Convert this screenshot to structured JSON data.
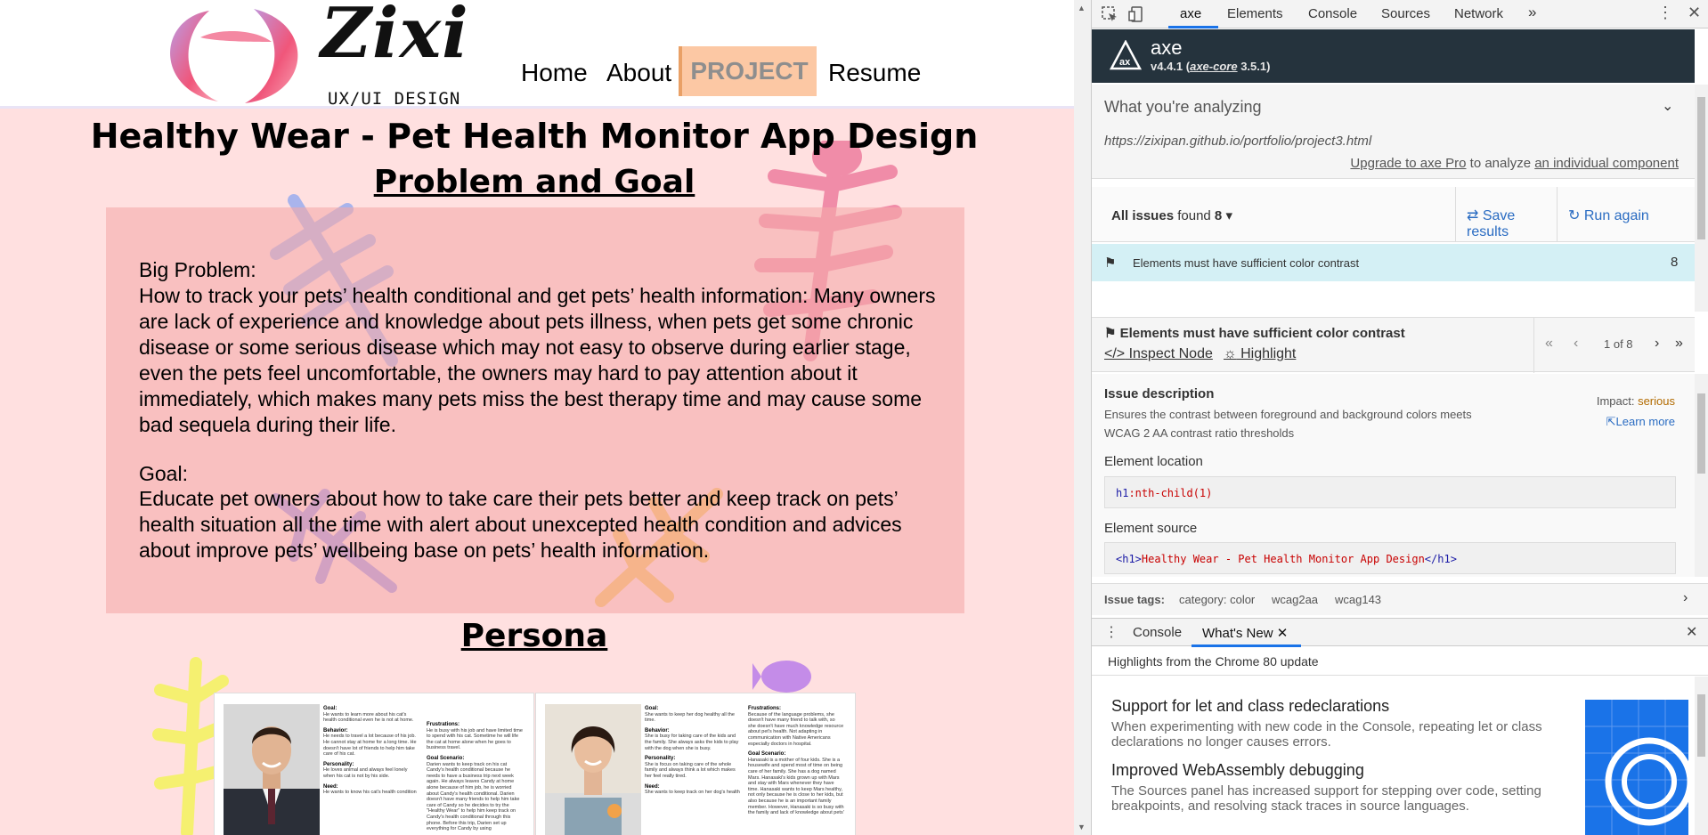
{
  "site": {
    "logo": {
      "text": "Zixi",
      "subtitle": "UX/UI DESIGN"
    },
    "nav": {
      "home": "Home",
      "about": "About",
      "project": "PROJECT",
      "resume": "Resume"
    },
    "title": "Healthy Wear - Pet Health Monitor App Design",
    "problem_section": {
      "heading": "Problem and Goal",
      "big_problem_label": "Big Problem:",
      "big_problem_text": "How to track your pets’ health conditional and get pets’ health information: Many owners are lack of experience and knowledge about pets illness, when pets get some chronic disease or some serious disease which may not easy to observe during earlier stage, even the pets feel uncomfortable, the owners may hard to pay attention about it immediately, which makes many pets miss the best therapy time and may cause some bad sequela during their life.",
      "goal_label": "Goal:",
      "goal_text": "Educate pet owners about how to take care their pets better and keep track on pets’ health situation all the time with alert about unexcepted health condition and advices about improve pets’ wellbeing base on pets’ health information."
    },
    "persona_heading": "Persona",
    "personas": [
      {
        "col1": [
          {
            "h": "Goal:",
            "t": "He wants to learn more about his cat's health conditional even he is not at home."
          },
          {
            "h": "Behavior:",
            "t": "He needs to travel a lot because of his job. He cannot stay at home for a long time. He doesn't have lot of friends to help him take care of his cat."
          },
          {
            "h": "Personality:",
            "t": "He loves animal and always feel lonely when his cat is not by his side."
          },
          {
            "h": "Need:",
            "t": "He wants to know his cat's health condition"
          }
        ],
        "col2": [
          {
            "h": "Frustrations:",
            "t": "He is busy with his job and have limited time to spend with his cat. Sometime he will life the cat at home alone when he goes to business travel."
          },
          {
            "h": "Goal Scenario:",
            "t": "Darien wants to keep track on his cat Candy's health conditional because he needs to have a business trip next week again. He always leaves Candy at home alone because of him job, he is worried about Candy's health conditional. Darien doesn't have many friends to help him take care of Candy so he decides to try the \"Healthy Wear\" to help him keep track on Candy's health conditional through this phone. Before this trip, Darien set up everything for Candy by using"
          }
        ]
      },
      {
        "col1": [
          {
            "h": "Goal:",
            "t": "She wants to keep her dog healthy all the time."
          },
          {
            "h": "Behavior:",
            "t": "She is busy for taking care of the kids and the family. She always asks the kids to play with the dog when she is busy."
          },
          {
            "h": "Personality:",
            "t": "She is focus on taking care of the whole family and always think a lot which makes her feel really tired."
          },
          {
            "h": "Need:",
            "t": "She wants to keep track on her dog's health"
          }
        ],
        "col2": [
          {
            "h": "Frustrations:",
            "t": "Because of the language problems, she doesn't have many friend to talk with, so she doesn't have much knowledge resource about pet's health. Not adapting in communication with Native Americans especially doctors in hospital."
          },
          {
            "h": "Goal Scenario:",
            "t": "Hanasaki is a mother of four kids. She is a housewife and spend most of time on being care of her family. She has a dog named Mars. Hanasaki's kids grown up with Mars and stay with Mars whenever they have time. Hanasaki wants to keep Mars healthy, not only because he is close to her kids, but also because he is an important family member. However, Hanasaki is so busy with the family and lack of knowledge about pets'"
          }
        ]
      }
    ]
  },
  "devtools": {
    "tabs": [
      "axe",
      "Elements",
      "Console",
      "Sources",
      "Network"
    ],
    "more_tabs": "»",
    "axe": {
      "name": "axe",
      "version": "v4.4.1 (",
      "core_label": "axe-core",
      "core_version": " 3.5.1)",
      "analyzing_title": "What you're analyzing",
      "url": "https://zixipan.github.io/portfolio/project3.html",
      "upgrade_link": "Upgrade to axe Pro",
      "upgrade_mid": " to analyze ",
      "component_link": "an individual component",
      "issues_label": "All issues",
      "issues_found": " found ",
      "issues_count": "8",
      "save_results": "Save results",
      "run_again": "Run again",
      "issue_row_label": "Elements must have sufficient color contrast",
      "issue_row_count": "8",
      "detail_title": "Elements must have sufficient color contrast",
      "inspect_node": " Inspect Node",
      "highlight": " Highlight",
      "pager_label": "1 of 8",
      "desc_title": "Issue description",
      "desc_text": "Ensures the contrast between foreground and background colors meets WCAG 2 AA contrast ratio thresholds",
      "impact_label": "Impact: ",
      "impact_value": "serious",
      "learn_more": "Learn more",
      "location_title": "Element location",
      "location_tag": "h1",
      "location_pseudo": ":nth-child(1)",
      "source_title": "Element source",
      "source_open": "<h1>",
      "source_text": "Healthy Wear - Pet Health Monitor App Design",
      "source_close": "</h1>",
      "tags_label": "Issue tags:",
      "tags": [
        "category: color",
        "wcag2aa",
        "wcag143"
      ]
    },
    "drawer": {
      "console": "Console",
      "whats_new": "What's New",
      "highlights": "Highlights from the Chrome 80 update",
      "news": [
        {
          "title": "Support for let and class redeclarations",
          "desc": "When experimenting with new code in the Console, repeating let or class declarations no longer causes errors."
        },
        {
          "title": "Improved WebAssembly debugging",
          "desc": "The Sources panel has increased support for stepping over code, setting breakpoints, and resolving stack traces in source languages."
        }
      ]
    }
  },
  "colors": {
    "page_bg": "#ffe0e0",
    "card_bg": "#f5aaaa",
    "nav_active_bg": "#fcc8a4",
    "axe_header": "#25333d",
    "link_blue": "#2a6cc2",
    "issue_row_bg": "#d4f0f5",
    "impact_serious": "#b26b00"
  }
}
